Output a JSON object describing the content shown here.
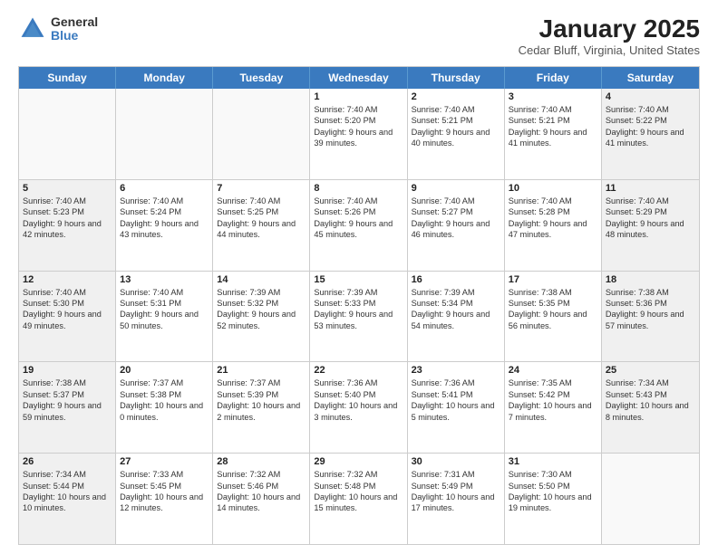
{
  "logo": {
    "general": "General",
    "blue": "Blue"
  },
  "title": "January 2025",
  "subtitle": "Cedar Bluff, Virginia, United States",
  "days": [
    "Sunday",
    "Monday",
    "Tuesday",
    "Wednesday",
    "Thursday",
    "Friday",
    "Saturday"
  ],
  "rows": [
    [
      {
        "day": "",
        "content": "",
        "empty": true
      },
      {
        "day": "",
        "content": "",
        "empty": true
      },
      {
        "day": "",
        "content": "",
        "empty": true
      },
      {
        "day": "1",
        "content": "Sunrise: 7:40 AM\nSunset: 5:20 PM\nDaylight: 9 hours and 39 minutes.",
        "shaded": false
      },
      {
        "day": "2",
        "content": "Sunrise: 7:40 AM\nSunset: 5:21 PM\nDaylight: 9 hours and 40 minutes.",
        "shaded": false
      },
      {
        "day": "3",
        "content": "Sunrise: 7:40 AM\nSunset: 5:21 PM\nDaylight: 9 hours and 41 minutes.",
        "shaded": false
      },
      {
        "day": "4",
        "content": "Sunrise: 7:40 AM\nSunset: 5:22 PM\nDaylight: 9 hours and 41 minutes.",
        "shaded": true
      }
    ],
    [
      {
        "day": "5",
        "content": "Sunrise: 7:40 AM\nSunset: 5:23 PM\nDaylight: 9 hours and 42 minutes.",
        "shaded": true
      },
      {
        "day": "6",
        "content": "Sunrise: 7:40 AM\nSunset: 5:24 PM\nDaylight: 9 hours and 43 minutes.",
        "shaded": false
      },
      {
        "day": "7",
        "content": "Sunrise: 7:40 AM\nSunset: 5:25 PM\nDaylight: 9 hours and 44 minutes.",
        "shaded": false
      },
      {
        "day": "8",
        "content": "Sunrise: 7:40 AM\nSunset: 5:26 PM\nDaylight: 9 hours and 45 minutes.",
        "shaded": false
      },
      {
        "day": "9",
        "content": "Sunrise: 7:40 AM\nSunset: 5:27 PM\nDaylight: 9 hours and 46 minutes.",
        "shaded": false
      },
      {
        "day": "10",
        "content": "Sunrise: 7:40 AM\nSunset: 5:28 PM\nDaylight: 9 hours and 47 minutes.",
        "shaded": false
      },
      {
        "day": "11",
        "content": "Sunrise: 7:40 AM\nSunset: 5:29 PM\nDaylight: 9 hours and 48 minutes.",
        "shaded": true
      }
    ],
    [
      {
        "day": "12",
        "content": "Sunrise: 7:40 AM\nSunset: 5:30 PM\nDaylight: 9 hours and 49 minutes.",
        "shaded": true
      },
      {
        "day": "13",
        "content": "Sunrise: 7:40 AM\nSunset: 5:31 PM\nDaylight: 9 hours and 50 minutes.",
        "shaded": false
      },
      {
        "day": "14",
        "content": "Sunrise: 7:39 AM\nSunset: 5:32 PM\nDaylight: 9 hours and 52 minutes.",
        "shaded": false
      },
      {
        "day": "15",
        "content": "Sunrise: 7:39 AM\nSunset: 5:33 PM\nDaylight: 9 hours and 53 minutes.",
        "shaded": false
      },
      {
        "day": "16",
        "content": "Sunrise: 7:39 AM\nSunset: 5:34 PM\nDaylight: 9 hours and 54 minutes.",
        "shaded": false
      },
      {
        "day": "17",
        "content": "Sunrise: 7:38 AM\nSunset: 5:35 PM\nDaylight: 9 hours and 56 minutes.",
        "shaded": false
      },
      {
        "day": "18",
        "content": "Sunrise: 7:38 AM\nSunset: 5:36 PM\nDaylight: 9 hours and 57 minutes.",
        "shaded": true
      }
    ],
    [
      {
        "day": "19",
        "content": "Sunrise: 7:38 AM\nSunset: 5:37 PM\nDaylight: 9 hours and 59 minutes.",
        "shaded": true
      },
      {
        "day": "20",
        "content": "Sunrise: 7:37 AM\nSunset: 5:38 PM\nDaylight: 10 hours and 0 minutes.",
        "shaded": false
      },
      {
        "day": "21",
        "content": "Sunrise: 7:37 AM\nSunset: 5:39 PM\nDaylight: 10 hours and 2 minutes.",
        "shaded": false
      },
      {
        "day": "22",
        "content": "Sunrise: 7:36 AM\nSunset: 5:40 PM\nDaylight: 10 hours and 3 minutes.",
        "shaded": false
      },
      {
        "day": "23",
        "content": "Sunrise: 7:36 AM\nSunset: 5:41 PM\nDaylight: 10 hours and 5 minutes.",
        "shaded": false
      },
      {
        "day": "24",
        "content": "Sunrise: 7:35 AM\nSunset: 5:42 PM\nDaylight: 10 hours and 7 minutes.",
        "shaded": false
      },
      {
        "day": "25",
        "content": "Sunrise: 7:34 AM\nSunset: 5:43 PM\nDaylight: 10 hours and 8 minutes.",
        "shaded": true
      }
    ],
    [
      {
        "day": "26",
        "content": "Sunrise: 7:34 AM\nSunset: 5:44 PM\nDaylight: 10 hours and 10 minutes.",
        "shaded": true
      },
      {
        "day": "27",
        "content": "Sunrise: 7:33 AM\nSunset: 5:45 PM\nDaylight: 10 hours and 12 minutes.",
        "shaded": false
      },
      {
        "day": "28",
        "content": "Sunrise: 7:32 AM\nSunset: 5:46 PM\nDaylight: 10 hours and 14 minutes.",
        "shaded": false
      },
      {
        "day": "29",
        "content": "Sunrise: 7:32 AM\nSunset: 5:48 PM\nDaylight: 10 hours and 15 minutes.",
        "shaded": false
      },
      {
        "day": "30",
        "content": "Sunrise: 7:31 AM\nSunset: 5:49 PM\nDaylight: 10 hours and 17 minutes.",
        "shaded": false
      },
      {
        "day": "31",
        "content": "Sunrise: 7:30 AM\nSunset: 5:50 PM\nDaylight: 10 hours and 19 minutes.",
        "shaded": false
      },
      {
        "day": "",
        "content": "",
        "empty": true
      }
    ]
  ]
}
